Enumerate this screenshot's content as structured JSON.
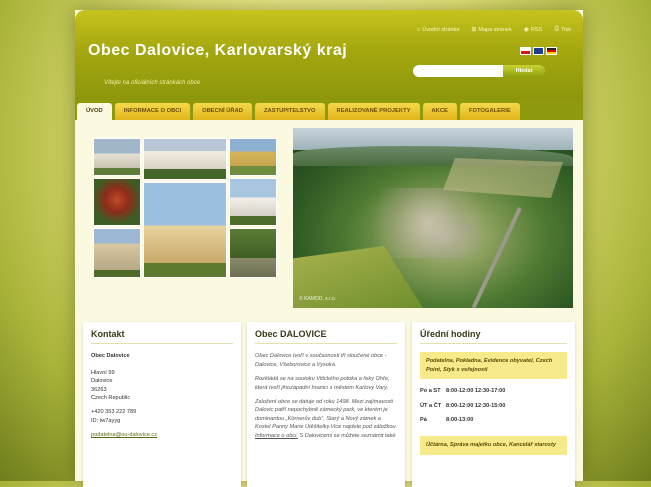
{
  "header": {
    "title": "Obec Dalovice, Karlovarský kraj",
    "subtitle": "Vítejte na oficiálních stránkách obce",
    "top_links": [
      {
        "icon": "home-icon",
        "label": "Úvodní stránka"
      },
      {
        "icon": "sitemap-icon",
        "label": "Mapa stránek"
      },
      {
        "icon": "rss-icon",
        "label": "RSS"
      },
      {
        "icon": "print-icon",
        "label": "Tisk"
      }
    ],
    "search_placeholder": "",
    "search_button": "Hledat"
  },
  "nav": {
    "tabs": [
      {
        "label": "ÚVOD",
        "active": true
      },
      {
        "label": "INFORMACE O OBCI",
        "active": false
      },
      {
        "label": "OBECNÍ ÚŘAD",
        "active": false
      },
      {
        "label": "ZASTUPITELSTVO",
        "active": false
      },
      {
        "label": "REALIZOVANÉ PROJEKTY",
        "active": false
      },
      {
        "label": "AKCE",
        "active": false
      },
      {
        "label": "FOTOGALERIE",
        "active": false
      }
    ]
  },
  "hero": {
    "credit": "© KAMOD, s.r.o."
  },
  "contact": {
    "heading": "Kontakt",
    "name": "Obec Dalovice",
    "street": "Hlavní 99",
    "town": "Dalovice",
    "zip": "36263",
    "country": "Czech Republic",
    "phone": "+420 353 222 789",
    "id": "ID: tw7ayyg",
    "email": "podatelna@ou-dalovice.cz"
  },
  "about": {
    "heading": "Obec DALOVICE",
    "p1": "Obec Dalovice tvoří v současnosti tři sloučené obce - Dalovice, Všeborovice a Vysoká.",
    "p2": "Rozkládá se na soutoku Vitického potoka a řeky Ohře, která tvoří jihozápadní hranici s městem Karlovy Vary.",
    "p3": "Založení obce se datuje od roku 1498. Mezi zajímavosti Dalovic patří nepochybně zámecký park, ve kterém je dominantou „Körnerův dub“, Starý a Nový zámek a Kostel Panny Marie Utěšitelky.Vice najdete pod záložkou",
    "p3_link": "Informace o obci.",
    "p3_tail": "S Dalovicemi se můžete seznámit také"
  },
  "hours": {
    "heading": "Úřední hodiny",
    "box1": "Podatelna, Pokladna, Evidence obyvatel, Czech Point, Styk s veřejností",
    "rows": [
      {
        "day": "Po a ST",
        "time": "8:00-12:00  12:30-17:00"
      },
      {
        "day": "ÚT a ČT",
        "time": "8:00-12:00  12:30-15:00"
      },
      {
        "day": "Pá",
        "time": "8:00-13:00"
      }
    ],
    "box2": "Účtárna, Správa majetku obce, Kancelář starosty"
  },
  "colors": {
    "header": "#a4a70f",
    "tab": "#e3b51b",
    "page_bg": "#fbf9df"
  }
}
